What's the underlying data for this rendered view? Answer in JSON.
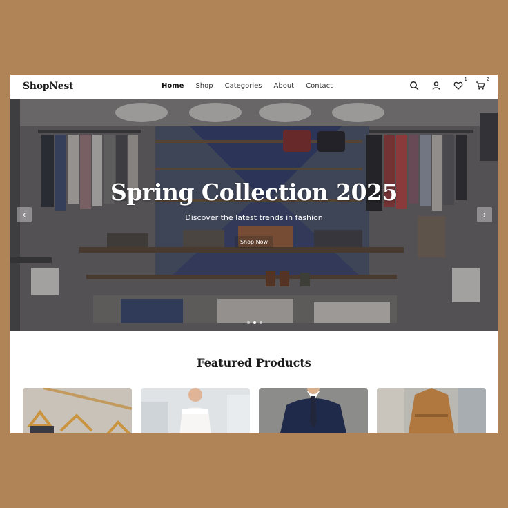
{
  "brand": {
    "name": "ShopNest"
  },
  "nav": {
    "items": [
      {
        "label": "Home",
        "active": true
      },
      {
        "label": "Shop"
      },
      {
        "label": "Categories"
      },
      {
        "label": "About"
      },
      {
        "label": "Contact"
      }
    ],
    "icons": [
      "search-icon",
      "user-icon",
      "heart-icon",
      "cart-icon"
    ],
    "wishlist_count": "1",
    "cart_count": "2"
  },
  "hero": {
    "title": "Spring Collection 2025",
    "subtitle": "Discover the latest trends in fashion",
    "button_label": "Shop Now",
    "prev_arrow": "‹",
    "next_arrow": "›",
    "slides": 3,
    "active_slide": 2
  },
  "featured": {
    "title": "Featured Products",
    "products": [
      {
        "image": "hangers-photo"
      },
      {
        "image": "white-dress-photo"
      },
      {
        "image": "navy-suit-photo"
      },
      {
        "image": "camel-coat-photo"
      }
    ]
  },
  "colors": {
    "page_background": "#b08457",
    "text": "#1a1a1a",
    "accent": "#ffffff"
  }
}
